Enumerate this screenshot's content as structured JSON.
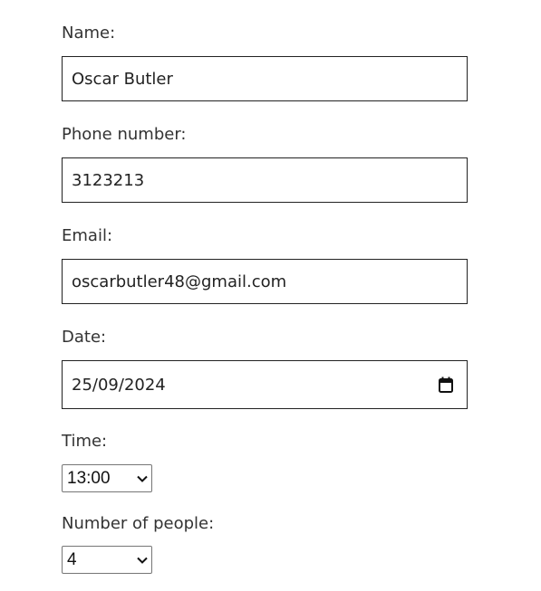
{
  "form": {
    "name": {
      "label": "Name:",
      "value": "Oscar Butler"
    },
    "phone": {
      "label": "Phone number:",
      "value": "3123213"
    },
    "email": {
      "label": "Email:",
      "value": "oscarbutler48@gmail.com"
    },
    "date": {
      "label": "Date:",
      "value": "25/09/2024",
      "icon": "calendar-icon"
    },
    "time": {
      "label": "Time:",
      "selected": "13:00",
      "icon": "chevron-down-icon"
    },
    "people": {
      "label": "Number of people:",
      "selected": "4",
      "icon": "chevron-down-icon"
    }
  }
}
